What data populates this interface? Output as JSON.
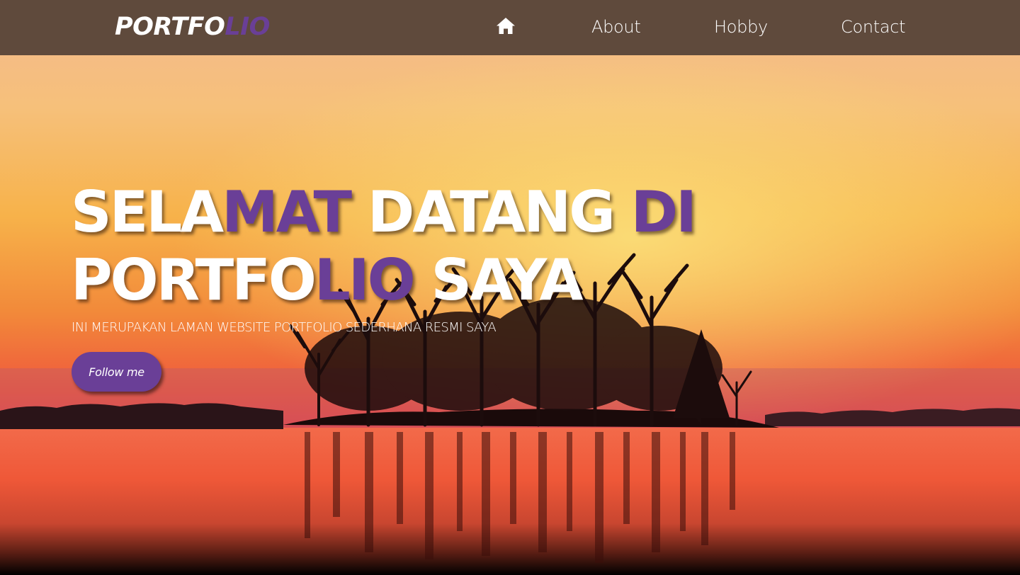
{
  "nav": {
    "brand_main": "PORTFO",
    "brand_accent": "LIO",
    "home_icon": "home-icon",
    "items": [
      {
        "label": "About"
      },
      {
        "label": "Hobby"
      },
      {
        "label": "Contact"
      }
    ]
  },
  "hero": {
    "title_line1": [
      {
        "text": "SELA",
        "accent": false
      },
      {
        "text": "MAT",
        "accent": true
      },
      {
        "text": " DATANG ",
        "accent": false
      },
      {
        "text": "DI",
        "accent": true
      }
    ],
    "title_line2": [
      {
        "text": "PORTFO",
        "accent": false
      },
      {
        "text": "LIO",
        "accent": true
      },
      {
        "text": " SAYA",
        "accent": false
      }
    ],
    "subtitle": "INI MERUPAKAN LAMAN WEBSITE PORTFOLIO SEDERHANA RESMI SAYA",
    "button_label": "Follow me"
  },
  "colors": {
    "navbar": "#5a463a",
    "accent": "#6a3f97",
    "text": "#ffffff"
  }
}
